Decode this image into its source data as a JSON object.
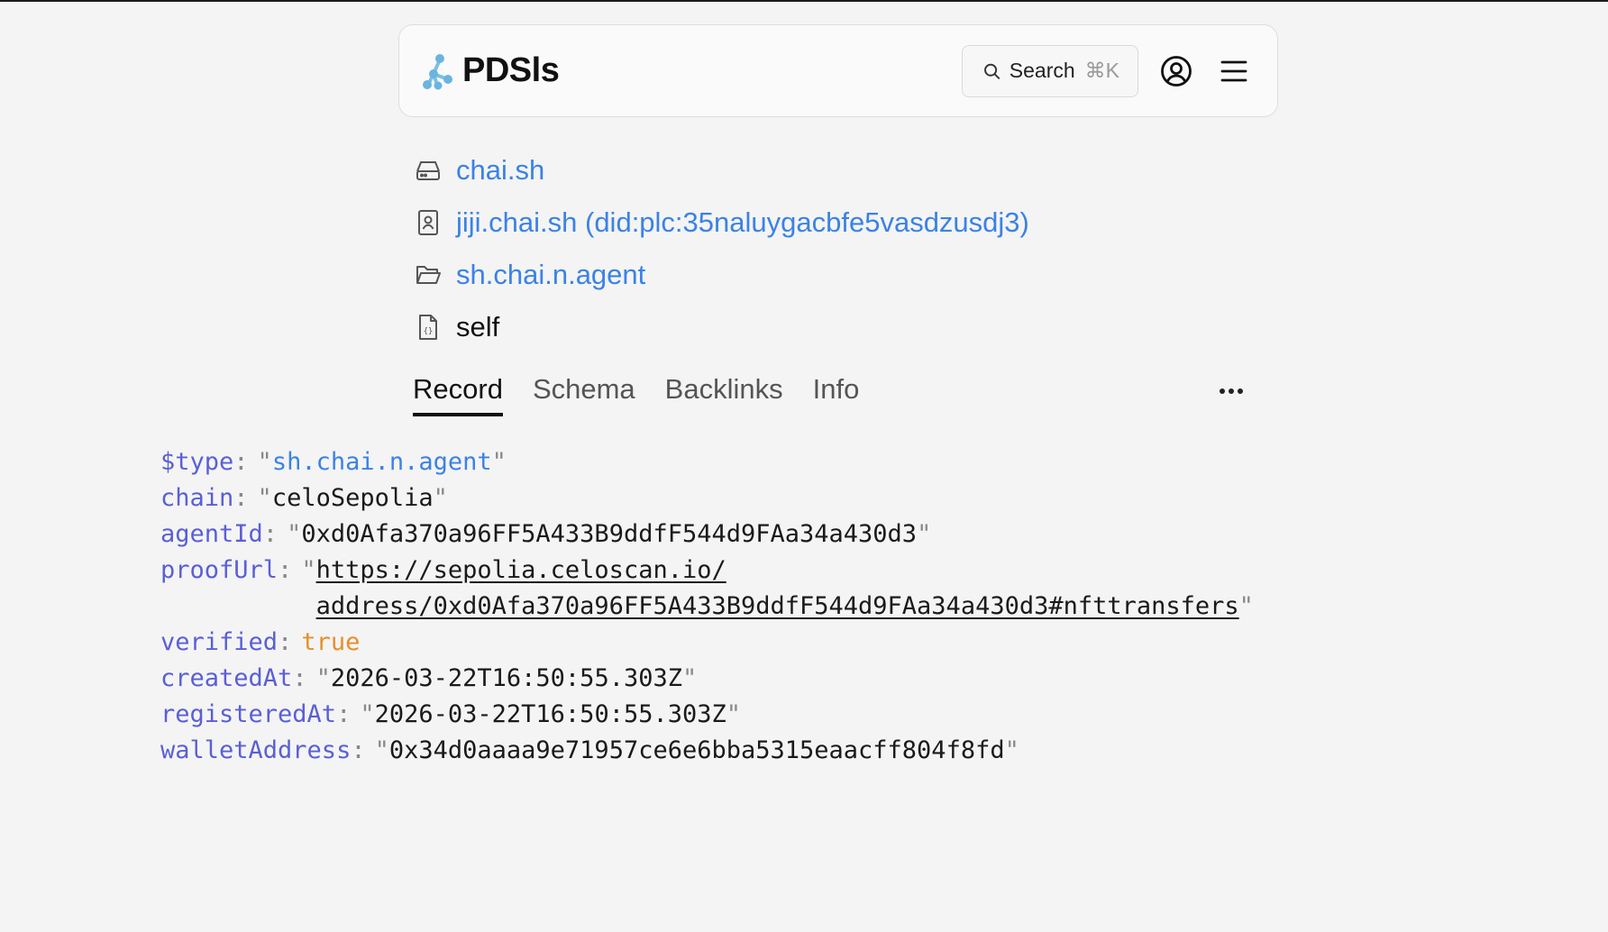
{
  "header": {
    "brand_icon": "network-nodes-icon",
    "brand_name": "PDSls",
    "search_label": "Search",
    "search_shortcut": "⌘K",
    "account_icon": "user-circle-icon",
    "menu_icon": "hamburger-menu-icon"
  },
  "breadcrumbs": [
    {
      "icon": "hard-drive-icon",
      "label": "chai.sh",
      "link": true
    },
    {
      "icon": "contact-card-icon",
      "label": "jiji.chai.sh (did:plc:35naluygacbfe5vasdzusdj3)",
      "link": true
    },
    {
      "icon": "folder-open-icon",
      "label": "sh.chai.n.agent",
      "link": true
    },
    {
      "icon": "json-file-icon",
      "label": "self",
      "link": false
    }
  ],
  "tabs": {
    "record": "Record",
    "schema": "Schema",
    "backlinks": "Backlinks",
    "info": "Info",
    "active": "Record",
    "more_icon": "more-horizontal-icon"
  },
  "record": {
    "type_key": "$type",
    "type_value": "sh.chai.n.agent",
    "chain_key": "chain",
    "chain_value": "celoSepolia",
    "agentId_key": "agentId",
    "agentId_value": "0xd0Afa370a96FF5A433B9ddfF544d9FAa34a430d3",
    "proofUrl_key": "proofUrl",
    "proofUrl_line1": "https://sepolia.celoscan.io/",
    "proofUrl_line2": "address/0xd0Afa370a96FF5A433B9ddfF544d9FAa34a430d3#nfttransfers",
    "verified_key": "verified",
    "verified_value": "true",
    "createdAt_key": "createdAt",
    "createdAt_value": "2026-03-22T16:50:55.303Z",
    "registeredAt_key": "registeredAt",
    "registeredAt_value": "2026-03-22T16:50:55.303Z",
    "walletAddress_key": "walletAddress",
    "walletAddress_value": "0x34d0aaaa9e71957ce6e6bba5315eaacff804f8fd"
  },
  "colors": {
    "background": "#f4f4f4",
    "link": "#3b82e6",
    "json_key": "#5a5fd6",
    "json_bool": "#e4902c"
  }
}
